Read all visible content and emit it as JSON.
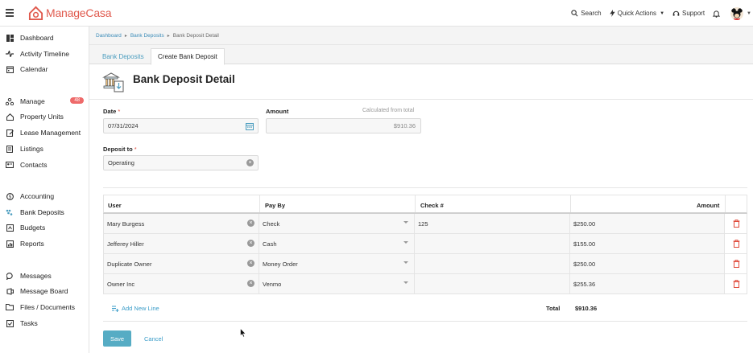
{
  "app": {
    "logo_prefix": "Manage",
    "logo_suffix": "Casa",
    "brand_color": "#e05a4e",
    "accent_color": "#56acc4"
  },
  "topbar": {
    "search": "Search",
    "quick_actions": "Quick Actions",
    "support": "Support"
  },
  "sidebar": {
    "items": [
      {
        "label": "Dashboard",
        "icon": "dashboard-icon"
      },
      {
        "label": "Activity Timeline",
        "icon": "activity-icon"
      },
      {
        "label": "Calendar",
        "icon": "calendar-icon"
      },
      {
        "label": "Manage",
        "icon": "manage-icon",
        "badge": "48"
      },
      {
        "label": "Property Units",
        "icon": "home-icon"
      },
      {
        "label": "Lease Management",
        "icon": "lease-icon"
      },
      {
        "label": "Listings",
        "icon": "listings-icon"
      },
      {
        "label": "Contacts",
        "icon": "contacts-icon"
      },
      {
        "label": "Accounting",
        "icon": "accounting-icon"
      },
      {
        "label": "Bank Deposits",
        "icon": "bank-deposits-icon"
      },
      {
        "label": "Budgets",
        "icon": "budgets-icon"
      },
      {
        "label": "Reports",
        "icon": "reports-icon"
      },
      {
        "label": "Messages",
        "icon": "messages-icon"
      },
      {
        "label": "Message Board",
        "icon": "message-board-icon"
      },
      {
        "label": "Files / Documents",
        "icon": "files-icon"
      },
      {
        "label": "Tasks",
        "icon": "tasks-icon"
      }
    ]
  },
  "breadcrumb": {
    "items": [
      "Dashboard",
      "Bank Deposits",
      "Bank Deposit Detail"
    ]
  },
  "tabs": [
    {
      "label": "Bank Deposits"
    },
    {
      "label": "Create Bank Deposit"
    }
  ],
  "page": {
    "title": "Bank Deposit Detail"
  },
  "form": {
    "date_label": "Date",
    "required_mark": "*",
    "date_value": "07/31/2024",
    "amount_label": "Amount",
    "amount_hint": "Calculated from total",
    "amount_value": "$910.36",
    "deposit_to_label": "Deposit to",
    "deposit_to_value": "Operating"
  },
  "table": {
    "headers": {
      "user": "User",
      "pay_by": "Pay By",
      "check": "Check #",
      "amount": "Amount"
    },
    "rows": [
      {
        "user": "Mary Burgess",
        "pay_by": "Check",
        "check": "125",
        "amount": "$250.00"
      },
      {
        "user": "Jefferey Hiller",
        "pay_by": "Cash",
        "check": "",
        "amount": "$155.00"
      },
      {
        "user": "Duplicate Owner",
        "pay_by": "Money Order",
        "check": "",
        "amount": "$250.00"
      },
      {
        "user": "Owner Inc",
        "pay_by": "Venmo",
        "check": "",
        "amount": "$255.36"
      }
    ],
    "add_line": "Add New Line",
    "total_label": "Total",
    "total_value": "$910.36"
  },
  "actions": {
    "save": "Save",
    "cancel": "Cancel"
  }
}
